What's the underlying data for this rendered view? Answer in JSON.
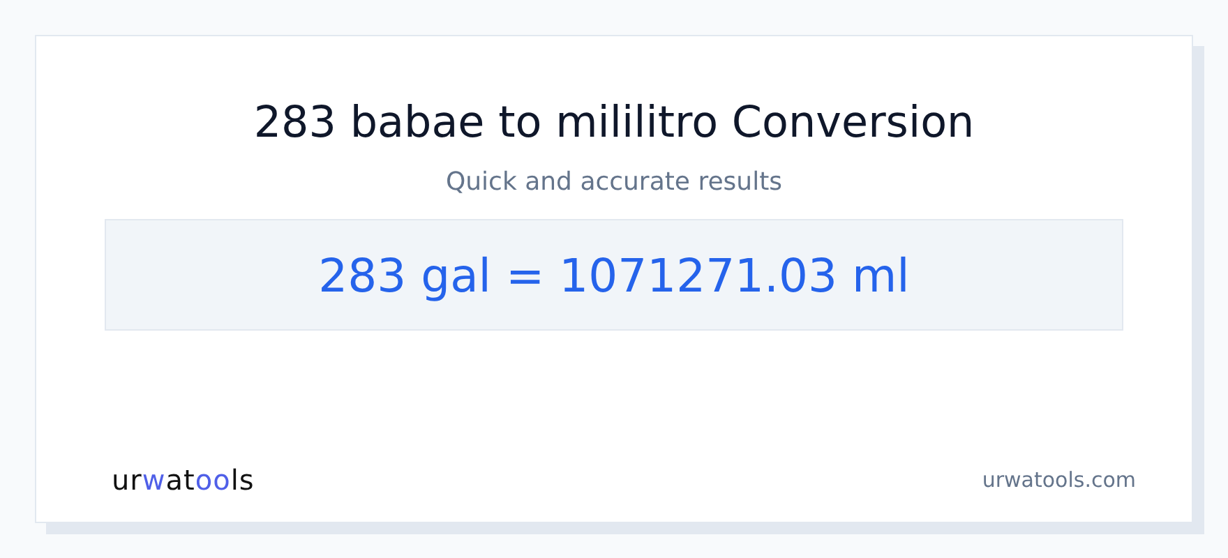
{
  "title": "283 babae to mililitro Conversion",
  "subtitle": "Quick and accurate results",
  "result": "283 gal = 1071271.03 ml",
  "logo": [
    {
      "text": "ur",
      "accent": false
    },
    {
      "text": "w",
      "accent": true
    },
    {
      "text": "at",
      "accent": false
    },
    {
      "text": "oo",
      "accent": true
    },
    {
      "text": "ls",
      "accent": false
    }
  ],
  "site": "urwatools.com"
}
